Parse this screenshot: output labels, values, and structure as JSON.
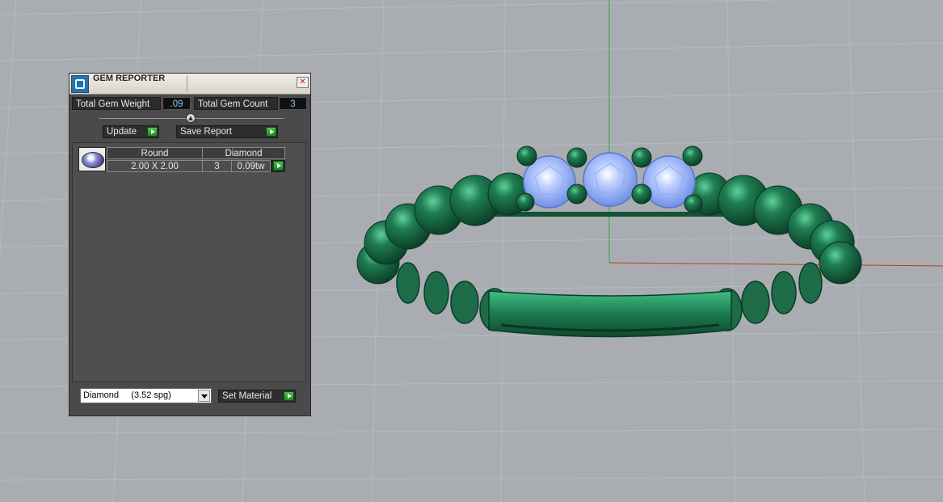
{
  "panel": {
    "title": "GEM REPORTER",
    "close_glyph": "✕",
    "total_weight_label": "Total Gem Weight",
    "total_weight_value": ".09",
    "total_count_label": "Total Gem Count",
    "total_count_value": "3",
    "update_label": "Update",
    "save_report_label": "Save Report",
    "gem_rows": [
      {
        "shape": "Round",
        "material": "Diamond",
        "size": "2.00 X 2.00",
        "count": "3",
        "weight": "0.09tw"
      }
    ],
    "material_select_value": "Diamond     (3.52 spg)",
    "set_material_label": "Set Material"
  },
  "icons": {
    "app": "gem-reporter-icon",
    "close": "close-icon",
    "go": "play-arrow-icon",
    "dropdown": "chevron-down-icon",
    "thumb": "gem-thumbnail-icon"
  },
  "colors": {
    "viewport_bg": "#a9adb1",
    "grid_line": "#b8bcc0",
    "x_axis": "#c0392b",
    "y_axis": "#27a84a",
    "ring_metal": "#1f6b45",
    "gem": "#8fb0ff"
  }
}
